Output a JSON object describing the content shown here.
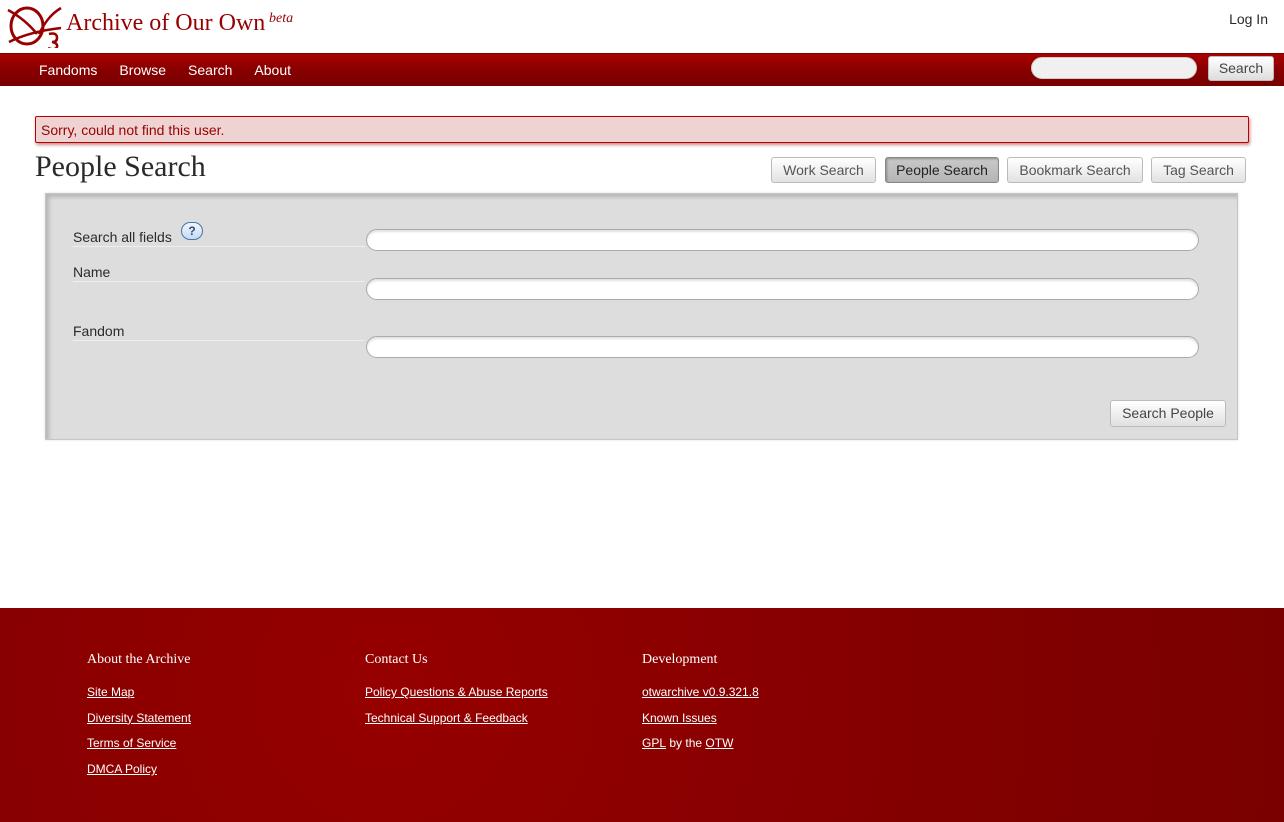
{
  "header": {
    "site_title": "Archive of Our Own",
    "beta": "beta",
    "login": "Log In"
  },
  "nav": {
    "items": [
      "Fandoms",
      "Browse",
      "Search",
      "About"
    ],
    "search_button": "Search",
    "search_value": ""
  },
  "flash": {
    "error": "Sorry, could not find this user."
  },
  "page": {
    "title": "People Search"
  },
  "tabs": [
    {
      "label": "Work Search",
      "current": false
    },
    {
      "label": "People Search",
      "current": true
    },
    {
      "label": "Bookmark Search",
      "current": false
    },
    {
      "label": "Tag Search",
      "current": false
    }
  ],
  "form": {
    "fields": [
      {
        "label": "Search all fields",
        "value": "",
        "help": "?"
      },
      {
        "label": "Name",
        "value": ""
      },
      {
        "label": "Fandom",
        "value": ""
      }
    ],
    "submit": "Search People"
  },
  "footer": {
    "about": {
      "heading": "About the Archive",
      "links": [
        "Site Map",
        "Diversity Statement",
        "Terms of Service",
        "DMCA Policy"
      ]
    },
    "contact": {
      "heading": "Contact Us",
      "links": [
        "Policy Questions & Abuse Reports",
        "Technical Support & Feedback"
      ]
    },
    "development": {
      "heading": "Development",
      "version": "otwarchive v0.9.321.8",
      "known_issues": "Known Issues",
      "gpl": "GPL",
      "by_the": "by the",
      "otw": "OTW"
    }
  },
  "colors": {
    "brand_red": "#990000",
    "error_bg": "#efd3d3",
    "panel_bg": "#dddddd"
  }
}
